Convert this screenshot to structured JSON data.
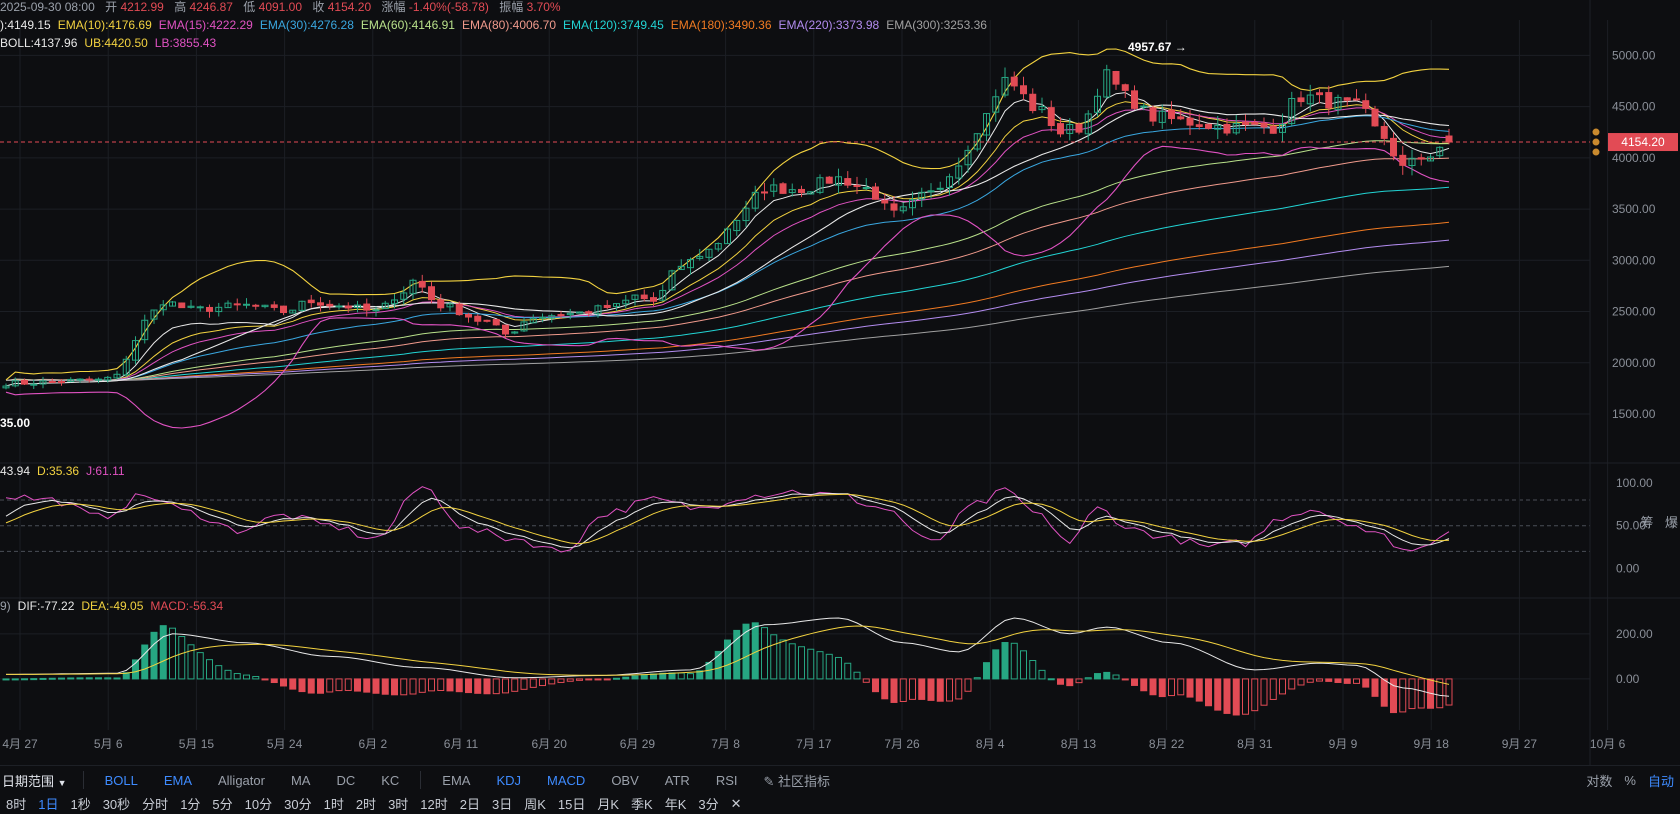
{
  "ohlc_legend": {
    "date": "2025-09-30 08:00",
    "open_label": "开",
    "open": "4212.99",
    "high_label": "高",
    "high": "4246.87",
    "low_label": "低",
    "low": "4091.00",
    "close_label": "收",
    "close": "4154.20",
    "change_label": "涨幅",
    "change": "-1.40%(-58.78)",
    "amp_label": "振幅",
    "amp": "3.70%"
  },
  "ema_legend": [
    {
      "text": "):4149.15",
      "color": "#e8e8e8"
    },
    {
      "text": "EMA(10):4176.69",
      "color": "#f2d240"
    },
    {
      "text": "EMA(15):4222.29",
      "color": "#e052c2"
    },
    {
      "text": "EMA(30):4276.28",
      "color": "#3aa7e0"
    },
    {
      "text": "EMA(60):4146.91",
      "color": "#b8e08a"
    },
    {
      "text": "EMA(80):4006.70",
      "color": "#f09a8c"
    },
    {
      "text": "EMA(120):3749.45",
      "color": "#22d4d4"
    },
    {
      "text": "EMA(180):3490.36",
      "color": "#f07a22"
    },
    {
      "text": "EMA(220):3373.98",
      "color": "#b38cf0"
    },
    {
      "text": "EMA(300):3253.36",
      "color": "#a0a0a0"
    }
  ],
  "boll_legend": [
    {
      "text": "BOLL:4137.96",
      "color": "#e8e8e8"
    },
    {
      "text": "UB:4420.50",
      "color": "#f2d240"
    },
    {
      "text": "LB:3855.43",
      "color": "#e052c2"
    }
  ],
  "kdj_legend": [
    {
      "text": "43.94",
      "color": "#e8e8e8"
    },
    {
      "text": "D:35.36",
      "color": "#f2d240"
    },
    {
      "text": "J:61.11",
      "color": "#e052c2"
    }
  ],
  "macd_legend": [
    {
      "text": "9)",
      "color": "#9aa0aa"
    },
    {
      "text": "DIF:-77.22",
      "color": "#e8e8e8"
    },
    {
      "text": "DEA:-49.05",
      "color": "#f2d240"
    },
    {
      "text": "MACD:-56.34",
      "color": "#e24b55"
    }
  ],
  "colors": {
    "up": "#26a682",
    "down": "#e24b55",
    "grid": "#1c1f25",
    "price_line": "#e24b55",
    "price_tag_bg": "#e24b55",
    "axis_text": "#8a8f98"
  },
  "price_tag": "4154.20",
  "annotations": {
    "high_label": "4957.67 →",
    "low_label": "35.00"
  },
  "toolbar_indicators": {
    "range_label": "日期范围",
    "main": [
      {
        "label": "BOLL",
        "active": true
      },
      {
        "label": "EMA",
        "active": true
      },
      {
        "label": "Alligator",
        "active": false
      },
      {
        "label": "MA",
        "active": false
      },
      {
        "label": "DC",
        "active": false
      },
      {
        "label": "KC",
        "active": false
      }
    ],
    "sub": [
      {
        "label": "EMA",
        "active": false
      },
      {
        "label": "KDJ",
        "active": true
      },
      {
        "label": "MACD",
        "active": true
      },
      {
        "label": "OBV",
        "active": false
      },
      {
        "label": "ATR",
        "active": false
      },
      {
        "label": "RSI",
        "active": false
      }
    ],
    "community": "社区指标",
    "right": [
      {
        "label": "对数",
        "active": false
      },
      {
        "label": "%",
        "active": false
      },
      {
        "label": "自动",
        "active": true
      }
    ]
  },
  "side_labels": [
    "筹",
    "爆"
  ],
  "toolbar_intervals": {
    "items": [
      {
        "label": "8时",
        "active": false
      },
      {
        "label": "1日",
        "active": true
      },
      {
        "label": "1秒",
        "active": false
      },
      {
        "label": "30秒",
        "active": false
      },
      {
        "label": "分时",
        "active": false
      },
      {
        "label": "1分",
        "active": false
      },
      {
        "label": "5分",
        "active": false
      },
      {
        "label": "10分",
        "active": false
      },
      {
        "label": "30分",
        "active": false
      },
      {
        "label": "1时",
        "active": false
      },
      {
        "label": "2时",
        "active": false
      },
      {
        "label": "3时",
        "active": false
      },
      {
        "label": "12时",
        "active": false
      },
      {
        "label": "2日",
        "active": false
      },
      {
        "label": "3日",
        "active": false
      },
      {
        "label": "周K",
        "active": false
      },
      {
        "label": "15日",
        "active": false
      },
      {
        "label": "月K",
        "active": false
      },
      {
        "label": "季K",
        "active": false
      },
      {
        "label": "年K",
        "active": false
      },
      {
        "label": "3分",
        "active": false
      }
    ],
    "close_symbol": "✕"
  },
  "chart_data": {
    "type": "candlestick",
    "x_ticks": [
      "4月 27",
      "5月 6",
      "5月 15",
      "5月 24",
      "6月 2",
      "6月 11",
      "6月 20",
      "6月 29",
      "7月 8",
      "7月 17",
      "7月 26",
      "8月 4",
      "8月 13",
      "8月 22",
      "8月 31",
      "9月 9",
      "9月 18",
      "9月 27",
      "10月 6"
    ],
    "price_axis": {
      "ticks": [
        1500,
        2000,
        2500,
        3000,
        3500,
        4000,
        4500,
        5000
      ],
      "labels": [
        "1500.00",
        "2000.00",
        "2500.00",
        "3000.00",
        "3500.00",
        "4000.00",
        "4500.00",
        "5000.00"
      ],
      "range": [
        1100,
        5150
      ]
    },
    "kdj_axis": {
      "ticks": [
        0,
        50,
        100
      ],
      "labels": [
        "0.00",
        "50.00",
        "100.00"
      ],
      "dashed": [
        20,
        50,
        80
      ],
      "range": [
        -25,
        115
      ]
    },
    "macd_axis": {
      "ticks": [
        0,
        200
      ],
      "labels": [
        "0.00",
        "200.00"
      ],
      "range": [
        -160,
        350
      ]
    },
    "price_keypoints": [
      [
        0,
        1800
      ],
      [
        10,
        1830
      ],
      [
        12,
        1870
      ],
      [
        13,
        2050
      ],
      [
        15,
        2400
      ],
      [
        17,
        2600
      ],
      [
        20,
        2520
      ],
      [
        26,
        2560
      ],
      [
        30,
        2500
      ],
      [
        33,
        2600
      ],
      [
        36,
        2560
      ],
      [
        40,
        2500
      ],
      [
        43,
        2700
      ],
      [
        44,
        2800
      ],
      [
        47,
        2560
      ],
      [
        52,
        2400
      ],
      [
        54,
        2280
      ],
      [
        57,
        2450
      ],
      [
        61,
        2480
      ],
      [
        66,
        2550
      ],
      [
        68,
        2650
      ],
      [
        70,
        2600
      ],
      [
        73,
        2950
      ],
      [
        76,
        3100
      ],
      [
        79,
        3400
      ],
      [
        82,
        3700
      ],
      [
        86,
        3700
      ],
      [
        90,
        3800
      ],
      [
        93,
        3700
      ],
      [
        96,
        3450
      ],
      [
        100,
        3650
      ],
      [
        103,
        3950
      ],
      [
        105,
        4300
      ],
      [
        108,
        4750
      ],
      [
        112,
        4450
      ],
      [
        114,
        4250
      ],
      [
        116,
        4300
      ],
      [
        119,
        4800
      ],
      [
        121,
        4600
      ],
      [
        124,
        4400
      ],
      [
        128,
        4350
      ],
      [
        132,
        4300
      ],
      [
        137,
        4300
      ],
      [
        140,
        4600
      ],
      [
        143,
        4550
      ],
      [
        146,
        4500
      ],
      [
        149,
        4200
      ],
      [
        151,
        3900
      ],
      [
        153,
        4000
      ],
      [
        156,
        4154
      ]
    ],
    "kdj_keypoints": [
      [
        0,
        85
      ],
      [
        5,
        80
      ],
      [
        10,
        60
      ],
      [
        15,
        85
      ],
      [
        20,
        65
      ],
      [
        25,
        45
      ],
      [
        30,
        62
      ],
      [
        35,
        50
      ],
      [
        40,
        35
      ],
      [
        45,
        95
      ],
      [
        50,
        45
      ],
      [
        55,
        35
      ],
      [
        60,
        20
      ],
      [
        65,
        65
      ],
      [
        70,
        80
      ],
      [
        75,
        70
      ],
      [
        80,
        85
      ],
      [
        85,
        90
      ],
      [
        90,
        85
      ],
      [
        95,
        70
      ],
      [
        100,
        30
      ],
      [
        105,
        75
      ],
      [
        108,
        90
      ],
      [
        112,
        60
      ],
      [
        115,
        30
      ],
      [
        118,
        70
      ],
      [
        122,
        45
      ],
      [
        126,
        35
      ],
      [
        130,
        25
      ],
      [
        134,
        30
      ],
      [
        138,
        60
      ],
      [
        141,
        70
      ],
      [
        145,
        55
      ],
      [
        148,
        40
      ],
      [
        152,
        20
      ],
      [
        156,
        44
      ]
    ],
    "macd_keypoints": [
      [
        0,
        20
      ],
      [
        12,
        25
      ],
      [
        18,
        200
      ],
      [
        26,
        160
      ],
      [
        35,
        100
      ],
      [
        45,
        50
      ],
      [
        55,
        5
      ],
      [
        64,
        15
      ],
      [
        74,
        40
      ],
      [
        82,
        240
      ],
      [
        90,
        270
      ],
      [
        97,
        160
      ],
      [
        103,
        120
      ],
      [
        109,
        270
      ],
      [
        115,
        200
      ],
      [
        119,
        230
      ],
      [
        126,
        160
      ],
      [
        135,
        40
      ],
      [
        142,
        70
      ],
      [
        146,
        60
      ],
      [
        151,
        -40
      ],
      [
        156,
        -77
      ]
    ],
    "bar_spacing_days": 1,
    "candle_count": 157
  }
}
